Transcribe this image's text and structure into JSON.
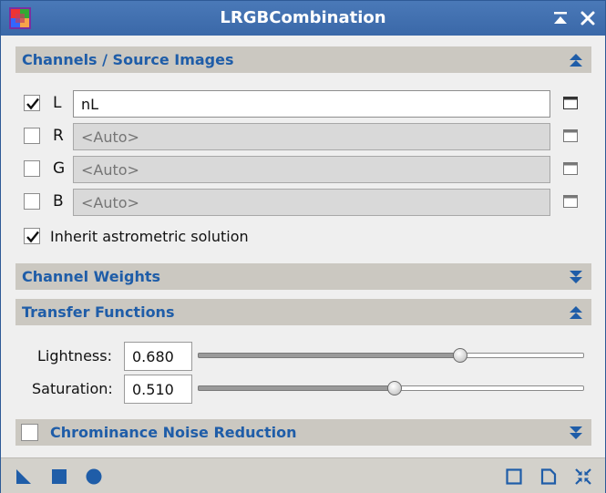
{
  "window": {
    "title": "LRGBCombination"
  },
  "titlebar": {
    "icons": {
      "app": "lrgb-app-icon",
      "shade": "shade-icon",
      "close": "close-icon"
    }
  },
  "colors": {
    "titlebar": "#3a68a8",
    "section_header_bg": "#cbc8c1",
    "section_title": "#1f5da8",
    "icon_blue": "#1f5da8"
  },
  "channels_section": {
    "title": "Channels / Source Images",
    "expanded": true,
    "channels": [
      {
        "label": "L",
        "checked": true,
        "value": "nL",
        "placeholder": "<Auto>"
      },
      {
        "label": "R",
        "checked": false,
        "value": "",
        "placeholder": "<Auto>"
      },
      {
        "label": "G",
        "checked": false,
        "value": "",
        "placeholder": "<Auto>"
      },
      {
        "label": "B",
        "checked": false,
        "value": "",
        "placeholder": "<Auto>"
      }
    ],
    "inherit": {
      "label": "Inherit astrometric solution",
      "checked": true
    }
  },
  "channel_weights_section": {
    "title": "Channel Weights",
    "expanded": false
  },
  "transfer_section": {
    "title": "Transfer Functions",
    "expanded": true,
    "lightness": {
      "label": "Lightness:",
      "value": "0.680",
      "level": 0.68
    },
    "saturation": {
      "label": "Saturation:",
      "value": "0.510",
      "level": 0.51
    }
  },
  "chrominance_section": {
    "title": "Chrominance Noise Reduction",
    "checked": false,
    "expanded": false
  },
  "bottombar": {
    "left_icons": [
      "new-instance-icon",
      "apply-global-icon",
      "apply-icon"
    ],
    "right_icons": [
      "browse-documentation-icon",
      "edit-icon",
      "reset-icon"
    ]
  }
}
